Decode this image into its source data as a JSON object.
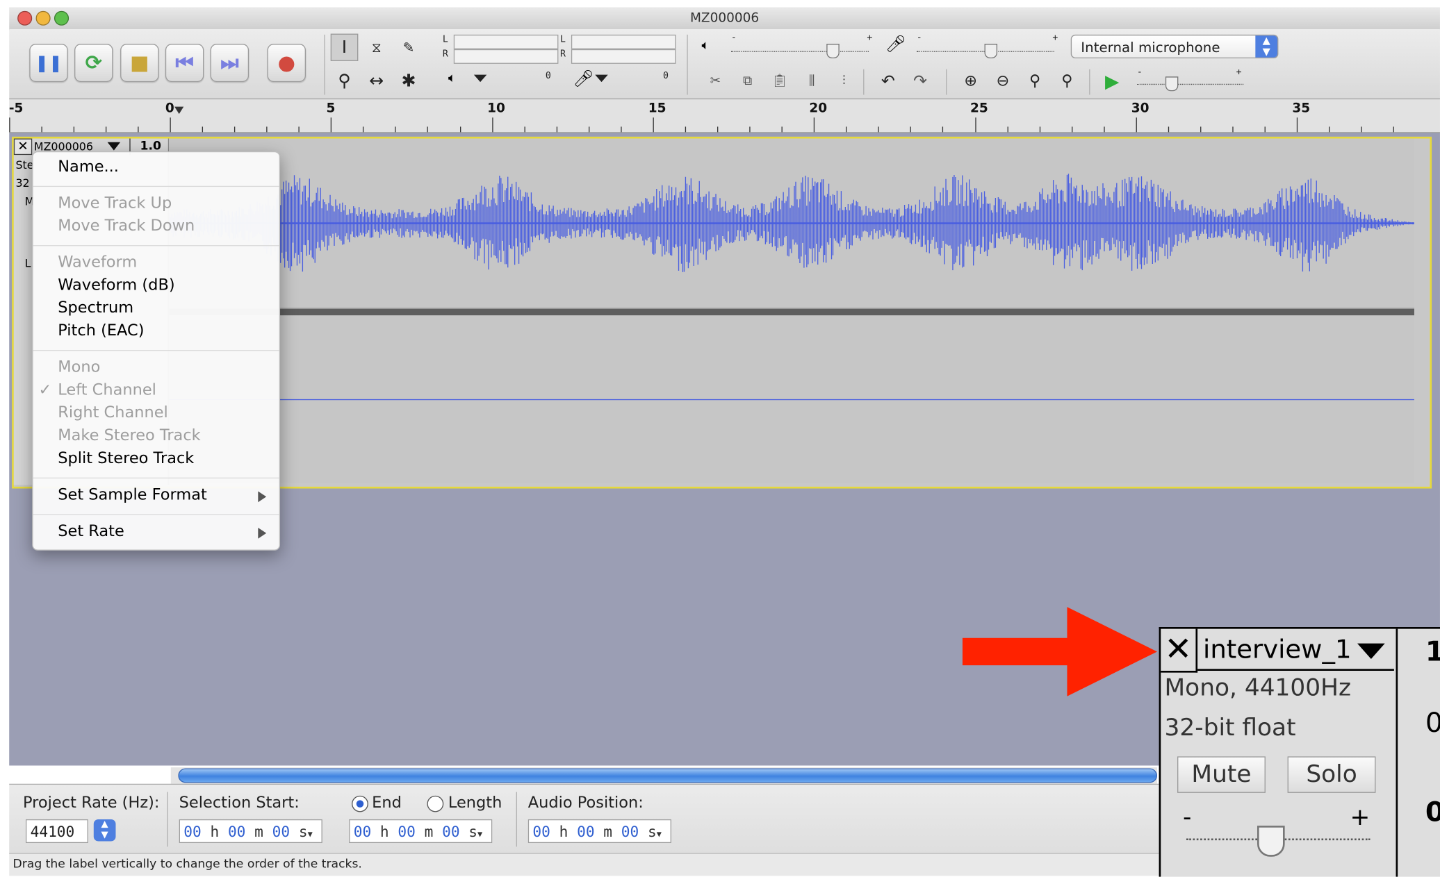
{
  "window": {
    "title": "MZ000006"
  },
  "toolbar": {
    "transport": [
      {
        "name": "pause-button",
        "glyph": "❚❚",
        "color": "#3b6fd4"
      },
      {
        "name": "loop-button",
        "glyph": "⟳",
        "color": "#3fa74a"
      },
      {
        "name": "stop-button",
        "glyph": "■",
        "color": "#c9a63a"
      },
      {
        "name": "skip-start-button",
        "glyph": "⏮",
        "color": "#7a7fe0"
      },
      {
        "name": "skip-end-button",
        "glyph": "⏭",
        "color": "#7a7fe0"
      },
      {
        "name": "record-button",
        "glyph": "●",
        "color": "#d24a3f"
      }
    ],
    "meter_labels": {
      "left": "L",
      "right": "R",
      "zero": "0"
    },
    "volume": {
      "minus": "-",
      "plus": "+",
      "output_level": 0.73,
      "input_level": 0.53
    },
    "input_device": "Internal microphone",
    "playback_speed": {
      "minus": "-",
      "plus": "+",
      "level": 0.32
    }
  },
  "ruler": {
    "labels": [
      "-5",
      "0",
      "5",
      "10",
      "15",
      "20",
      "25",
      "30",
      "35"
    ]
  },
  "track": {
    "name": "MZ000006",
    "zoom_value": "1.0",
    "info_partial": [
      "Ste",
      "32",
      "M",
      "L"
    ]
  },
  "menu": {
    "items": [
      {
        "label": "Name...",
        "enabled": true
      },
      {
        "label": "Move Track Up",
        "enabled": false
      },
      {
        "label": "Move Track Down",
        "enabled": false
      },
      {
        "label": "Waveform",
        "enabled": false
      },
      {
        "label": "Waveform (dB)",
        "enabled": true
      },
      {
        "label": "Spectrum",
        "enabled": true
      },
      {
        "label": "Pitch (EAC)",
        "enabled": true
      },
      {
        "label": "Mono",
        "enabled": false
      },
      {
        "label": "Left Channel",
        "enabled": false,
        "checked": true
      },
      {
        "label": "Right Channel",
        "enabled": false
      },
      {
        "label": "Make Stereo Track",
        "enabled": false
      },
      {
        "label": "Split Stereo Track",
        "enabled": true
      },
      {
        "label": "Set Sample Format",
        "enabled": true,
        "submenu": true
      },
      {
        "label": "Set Rate",
        "enabled": true,
        "submenu": true
      }
    ],
    "check_glyph": "✓"
  },
  "bottom": {
    "project_rate_label": "Project Rate (Hz):",
    "project_rate_value": "44100",
    "selection_start_label": "Selection Start:",
    "end_label": "End",
    "length_label": "Length",
    "audio_position_label": "Audio Position:",
    "time": {
      "h_val": "00",
      "h_unit": "h",
      "m_val": "00",
      "m_unit": "m",
      "s_val": "00",
      "s_unit": "s"
    }
  },
  "status_text": "Drag the label vertically to change the order of the tracks.",
  "inset": {
    "track_name": "interview_1",
    "line1": "Mono, 44100Hz",
    "line2": "32-bit float",
    "mute": "Mute",
    "solo": "Solo",
    "minus": "-",
    "plus": "+",
    "right_partial": [
      "1",
      "0",
      "0"
    ],
    "gain_level": 0.45
  },
  "colors": {
    "wave": "#4a5fe0",
    "arrow": "#ff2200",
    "track_border": "#e6d93a"
  }
}
